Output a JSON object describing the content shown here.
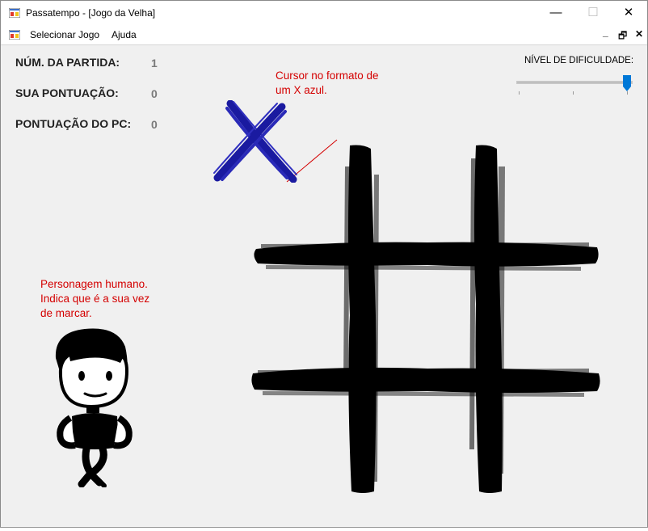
{
  "window": {
    "title": "Passatempo - [Jogo da Velha]",
    "minimize_glyph": "—",
    "maximize_glyph": "☐",
    "close_glyph": "✕"
  },
  "menu": {
    "items": [
      {
        "label": "Selecionar Jogo"
      },
      {
        "label": "Ajuda"
      }
    ],
    "mdi_minimize": "_",
    "mdi_restore": "🗗",
    "mdi_close": "✕"
  },
  "stats": {
    "match_label": "NÚM. DA PARTIDA:",
    "match_value": "1",
    "score_label": "SUA  PONTUAÇÃO:",
    "score_value": "0",
    "pc_label": "PONTUAÇÃO DO PC:",
    "pc_value": "0"
  },
  "difficulty": {
    "label": "NÍVEL DE DIFICULDADE:",
    "level_fraction": 1.0
  },
  "annotations": {
    "cursor_note_line1": "Cursor no formato de",
    "cursor_note_line2": "um X azul.",
    "human_note_line1": "Personagem humano.",
    "human_note_line2": "Indica que é a sua vez",
    "human_note_line3": "de marcar."
  },
  "icons": {
    "cursor": "x-cursor-icon",
    "character": "human-character",
    "board": "tic-tac-toe-board"
  },
  "colors": {
    "annotation": "#d40000",
    "x_cursor": "#1a1aa0",
    "slider_thumb": "#0078d7",
    "board": "#000000"
  }
}
